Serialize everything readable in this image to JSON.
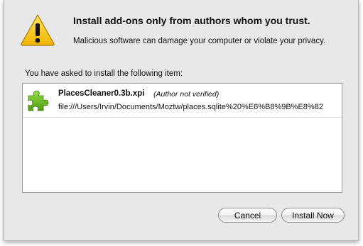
{
  "dialog": {
    "heading": "Install add-ons only from authors whom you trust.",
    "subtext": "Malicious software can damage your computer or violate your privacy.",
    "list_label": "You have asked to install the following item:"
  },
  "items": [
    {
      "name": "PlacesCleaner0.3b.xpi",
      "note": "(Author not verified)",
      "url": "file:///Users/Irvin/Documents/Moztw/places.sqlite%20%E6%B8%9B%E8%82"
    }
  ],
  "buttons": {
    "cancel": "Cancel",
    "install": "Install Now"
  },
  "icons": {
    "warning": "warning-triangle-icon",
    "addon": "puzzle-piece-icon"
  },
  "colors": {
    "warning_yellow": "#f5c400",
    "addon_green": "#6cbf1f",
    "dialog_background": "#e8e8e8"
  }
}
